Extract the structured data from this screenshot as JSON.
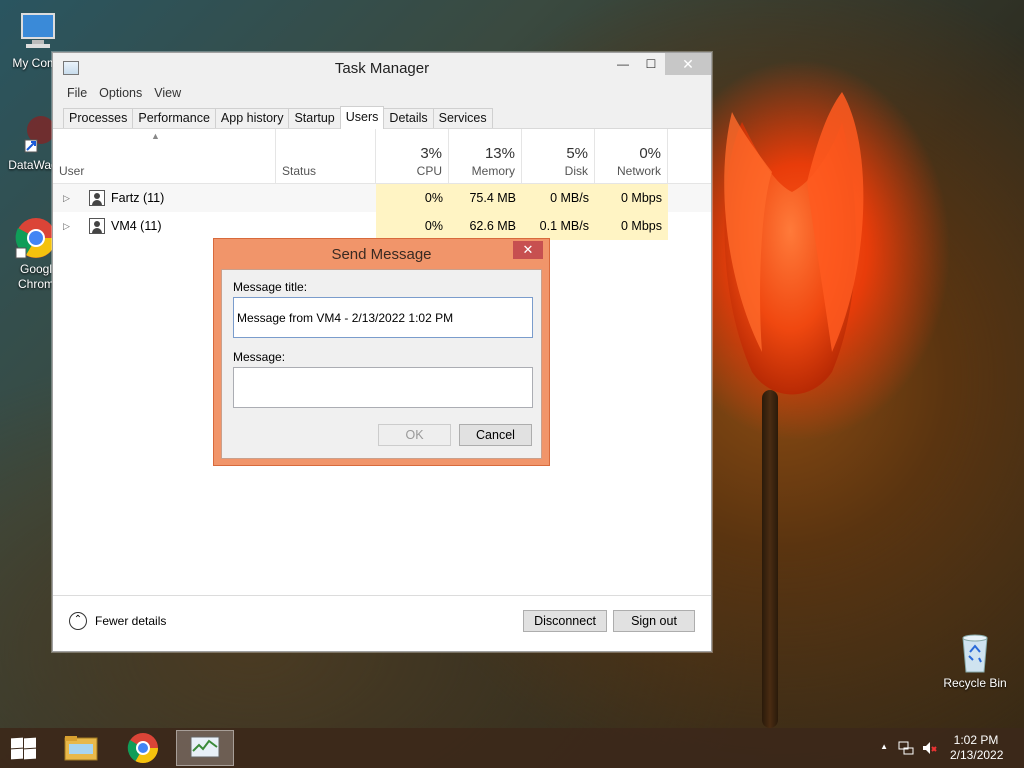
{
  "desktop": {
    "icons": [
      {
        "label": "My Comp"
      },
      {
        "label": "DataWag"
      },
      {
        "label": "Googl",
        "label2": "Chrom"
      },
      {
        "label": "Recycle Bin"
      }
    ]
  },
  "task_manager": {
    "title": "Task Manager",
    "window_controls": {
      "minimize": "—",
      "maximize": "☐",
      "close": "✕"
    },
    "menu": [
      "File",
      "Options",
      "View"
    ],
    "tabs": [
      "Processes",
      "Performance",
      "App history",
      "Startup",
      "Users",
      "Details",
      "Services"
    ],
    "active_tab": "Users",
    "columns": {
      "user": "User",
      "status": "Status",
      "cpu": {
        "pct": "3%",
        "label": "CPU"
      },
      "memory": {
        "pct": "13%",
        "label": "Memory"
      },
      "disk": {
        "pct": "5%",
        "label": "Disk"
      },
      "network": {
        "pct": "0%",
        "label": "Network"
      }
    },
    "rows": [
      {
        "user": "Fartz (11)",
        "status": "",
        "cpu": "0%",
        "memory": "75.4 MB",
        "disk": "0 MB/s",
        "network": "0 Mbps"
      },
      {
        "user": "VM4 (11)",
        "status": "",
        "cpu": "0%",
        "memory": "62.6 MB",
        "disk": "0.1 MB/s",
        "network": "0 Mbps"
      }
    ],
    "footer": {
      "fewer_details": "Fewer details",
      "disconnect": "Disconnect",
      "sign_out": "Sign out"
    }
  },
  "send_message": {
    "title": "Send Message",
    "close": "✕",
    "title_label": "Message title:",
    "title_value": "Message from VM4 - 2/13/2022 1:02 PM",
    "message_label": "Message:",
    "message_value": "",
    "ok": "OK",
    "cancel": "Cancel"
  },
  "taskbar": {
    "time": "1:02 PM",
    "date": "2/13/2022",
    "tray_arrow": "▲"
  },
  "colors": {
    "dialog_frame": "#f1956a",
    "highlight_cell": "#fff4c4",
    "close_red": "#c75050"
  }
}
